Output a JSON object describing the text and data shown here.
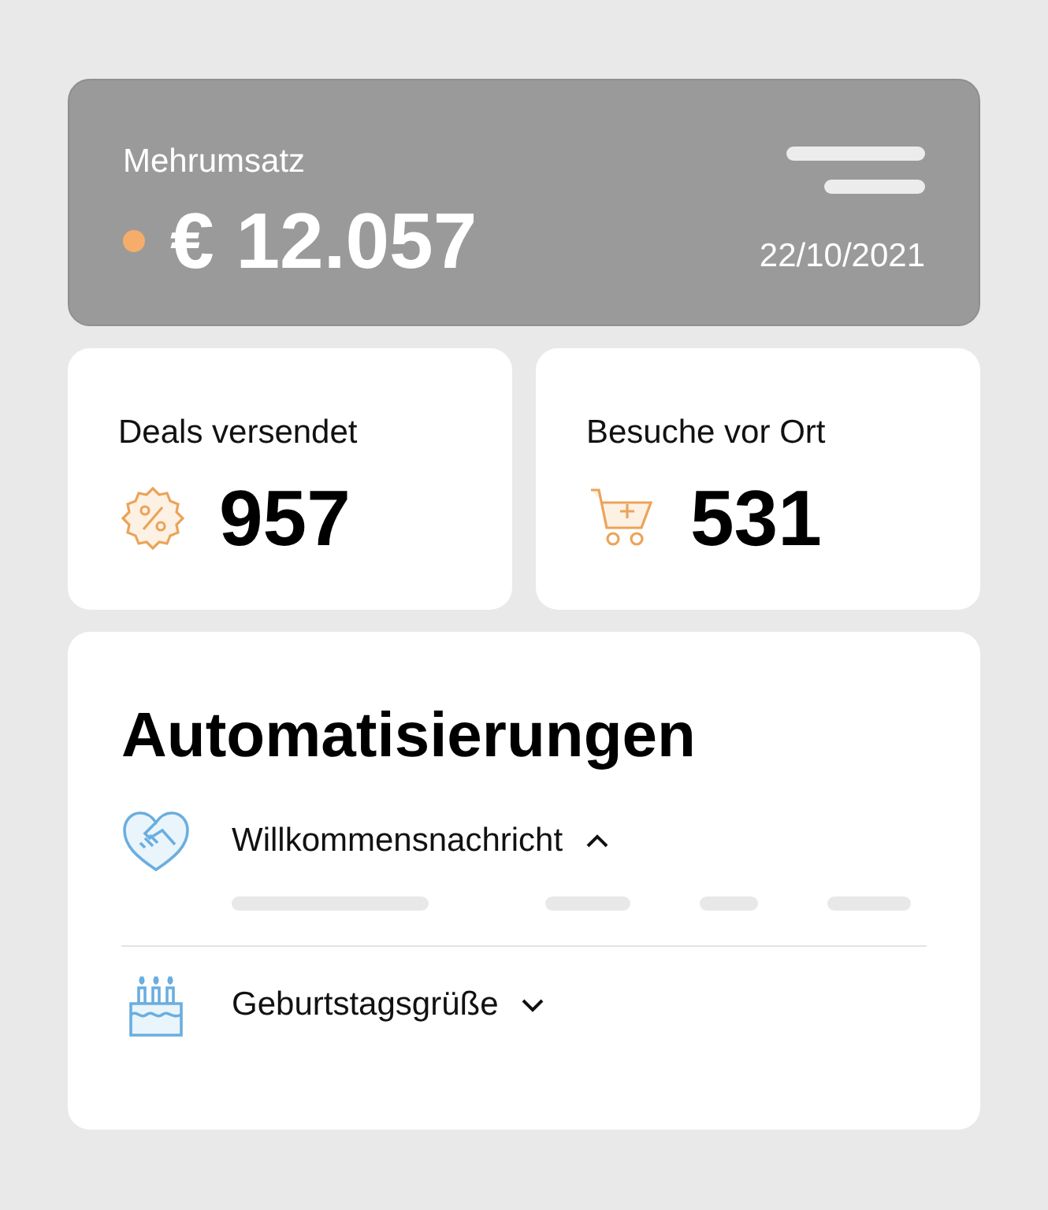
{
  "revenue": {
    "label": "Mehrumsatz",
    "value": "€ 12.057",
    "date": "22/10/2021"
  },
  "stats": [
    {
      "kind": "deals",
      "label": "Deals versendet",
      "value": "957"
    },
    {
      "kind": "visits",
      "label": "Besuche vor Ort",
      "value": "531"
    }
  ],
  "automations": {
    "title": "Automatisierungen",
    "items": [
      {
        "kind": "welcome",
        "label": "Willkommensnachricht",
        "expanded": true
      },
      {
        "kind": "birthday",
        "label": "Geburtstagsgrüße",
        "expanded": false
      }
    ]
  }
}
